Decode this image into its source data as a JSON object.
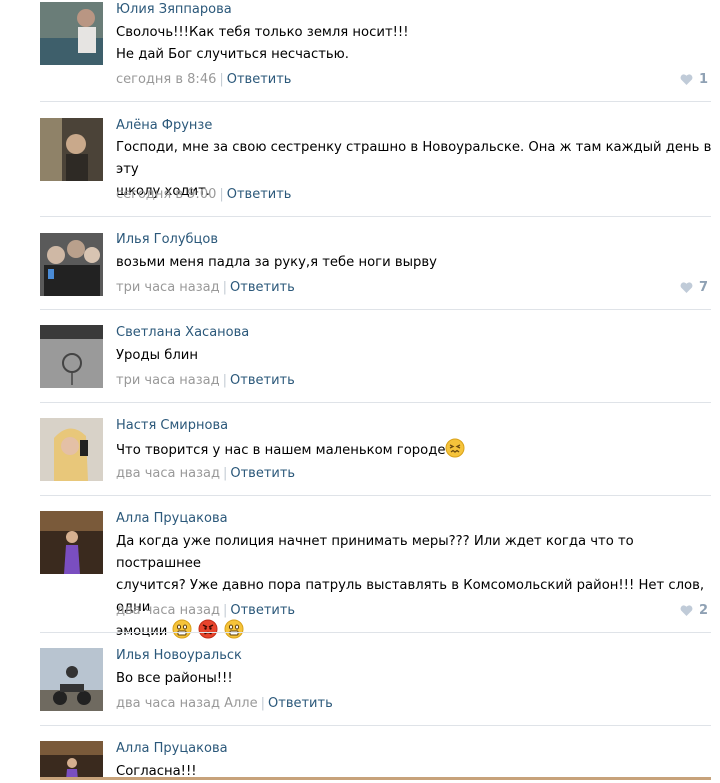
{
  "comments": [
    {
      "author": "Юлия Зяппарова",
      "lines": [
        "Сволочь!!!Как тебя только земля носит!!!",
        "Не дай Бог случиться несчастью."
      ],
      "time": "сегодня в 8:46",
      "reply": "Ответить",
      "likes": "1"
    },
    {
      "author": "Алёна Фрунзе",
      "lines": [
        "Господи, мне за свою сестренку страшно в Новоуральске. Она ж там каждый день в эту",
        "школу ходит."
      ],
      "time": "сегодня в 9:00",
      "reply": "Ответить",
      "likes": ""
    },
    {
      "author": "Илья Голубцов",
      "lines": [
        "возьми меня падла за руку,я тебе ноги вырву"
      ],
      "time": "три часа назад",
      "reply": "Ответить",
      "likes": "7"
    },
    {
      "author": "Светлана Хасанова",
      "lines": [
        "Уроды блин"
      ],
      "time": "три часа назад",
      "reply": "Ответить",
      "likes": ""
    },
    {
      "author": "Настя Смирнова",
      "lines": [
        "Что творится у нас в нашем маленьком городе"
      ],
      "time": "два часа назад",
      "reply": "Ответить",
      "likes": ""
    },
    {
      "author": "Алла Пруцакова",
      "lines": [
        "Да когда уже полиция начнет принимать меры??? Или ждет когда что то пострашнее",
        "случится? Уже давно пора патруль выставлять в Комсомольский район!!! Нет слов, одни",
        "эмоции"
      ],
      "time": "два часа назад",
      "reply": "Ответить",
      "likes": "2"
    },
    {
      "author": "Илья Новоуральск",
      "lines": [
        "Во все районы!!!"
      ],
      "time": "два часа назад Алле",
      "reply": "Ответить",
      "likes": ""
    },
    {
      "author": "Алла Пруцакова",
      "lines": [
        "Согласна!!!"
      ],
      "time": "",
      "reply": "",
      "likes": ""
    }
  ],
  "icons": {
    "like": "heart-icon",
    "emoji_confounded": "confounded-face-icon",
    "emoji_scream": "fearful-face-icon",
    "emoji_angry": "angry-face-icon"
  },
  "colors": {
    "link": "#2b587a",
    "meta": "#999999",
    "like": "#8fa1b4"
  }
}
